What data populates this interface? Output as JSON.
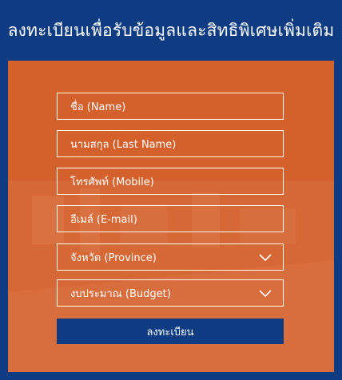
{
  "header": {
    "title": "ลงทะเบียนเพื่อรับข้อมูลและสิทธิพิเศษเพิ่มเติม"
  },
  "form": {
    "fields": [
      {
        "placeholder": "ชื่อ (Name)"
      },
      {
        "placeholder": "นามสกุล (Last Name)"
      },
      {
        "placeholder": "โทรศัพท์ (Mobile)"
      },
      {
        "placeholder": "อีเมล์ (E-mail)"
      }
    ],
    "selects": [
      {
        "placeholder": "จังหวัด (Province)",
        "icon": "chevron-down-icon"
      },
      {
        "placeholder": "งบประมาณ (Budget)",
        "icon": "chevron-down-icon"
      }
    ],
    "submit_label": "ลงทะเบียน"
  },
  "colors": {
    "header_bg": "#0d3c82",
    "panel_bg": "#d4612c",
    "submit_bg": "#0d3c82",
    "text": "#ffffff"
  }
}
